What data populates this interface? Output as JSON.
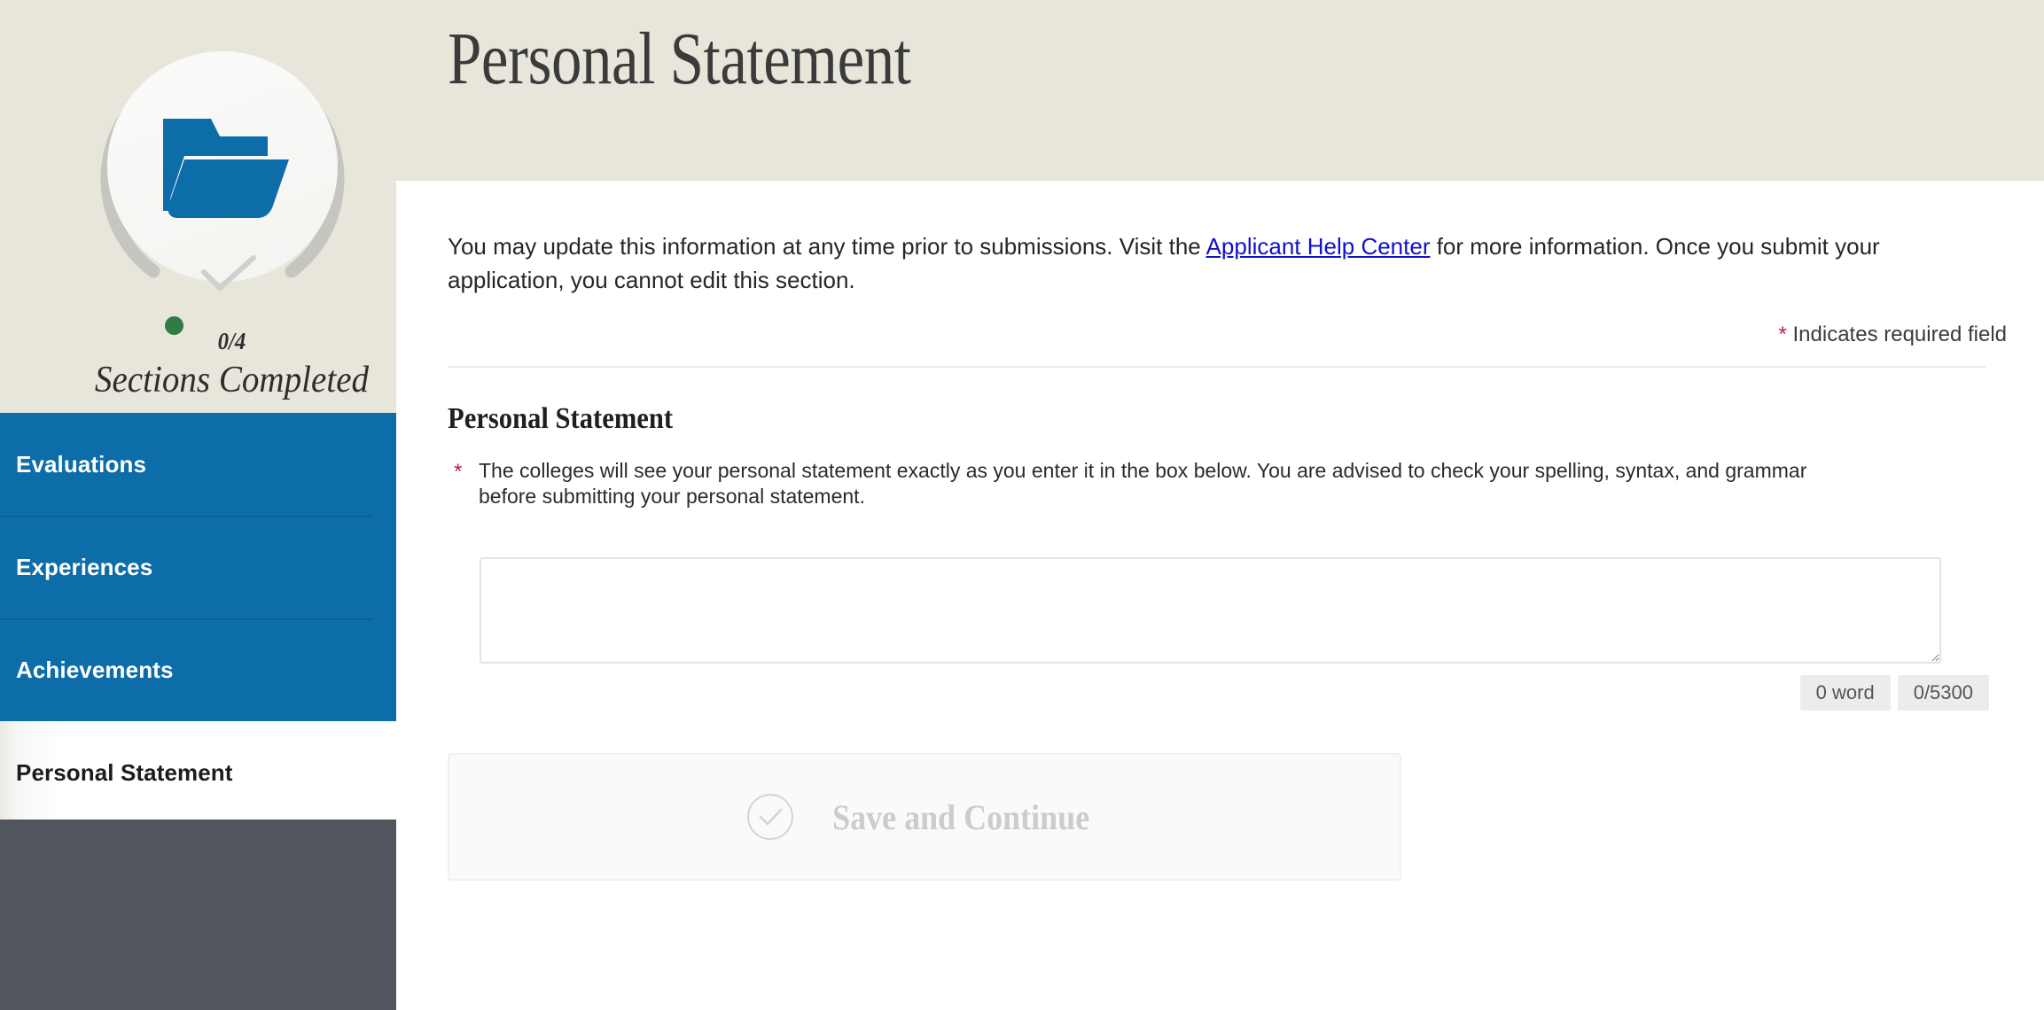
{
  "header": {
    "title": "Personal Statement"
  },
  "sidebar": {
    "progress": {
      "icon": "open-folder-icon",
      "check_icon": "checkmark-icon",
      "count": "0/4",
      "caption": "Sections Completed",
      "dot_color": "#2e7d44",
      "ring_color": "#c6c6c0",
      "folder_color": "#0d6da8"
    },
    "items": [
      {
        "label": "Evaluations",
        "active": false
      },
      {
        "label": "Experiences",
        "active": false
      },
      {
        "label": "Achievements",
        "active": false
      },
      {
        "label": "Personal Statement",
        "active": true
      }
    ],
    "accent_color": "#0d6da8",
    "footer_color": "#51565e",
    "background_color": "#e8e6db"
  },
  "main": {
    "intro": {
      "before_link": "You may update this information at any time prior to submissions. Visit the ",
      "link_text": "Applicant Help Center",
      "after_link": " for more information. Once you submit your application, you cannot edit this section."
    },
    "required_note": {
      "star": "*",
      "text": "Indicates required field",
      "star_color": "#c2185b"
    },
    "section_heading": "Personal Statement",
    "field": {
      "star": "*",
      "instruction": "The colleges will see your personal statement exactly as you enter it in the box below. You are advised to check your spelling, syntax, and grammar before submitting your personal statement.",
      "value": "",
      "placeholder": ""
    },
    "counters": {
      "words": "0 word",
      "characters": "0/5300"
    },
    "save_button": {
      "label": "Save and Continue",
      "icon": "circle-check-icon",
      "disabled": true
    }
  }
}
